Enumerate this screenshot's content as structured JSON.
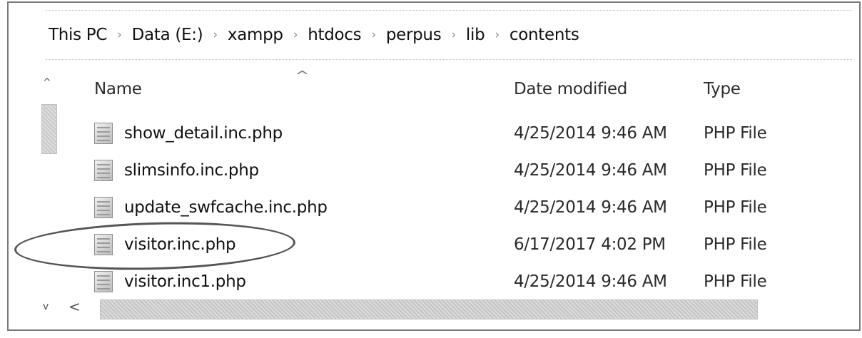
{
  "breadcrumb": {
    "items": [
      "This PC",
      "Data (E:)",
      "xampp",
      "htdocs",
      "perpus",
      "lib",
      "contents"
    ],
    "separator": "›"
  },
  "columns": {
    "name": "Name",
    "date_modified": "Date modified",
    "type": "Type",
    "sort_indicator": "^"
  },
  "files": [
    {
      "name": "show_detail.inc.php",
      "date": "4/25/2014 9:46 AM",
      "type": "PHP File"
    },
    {
      "name": "slimsinfo.inc.php",
      "date": "4/25/2014 9:46 AM",
      "type": "PHP File"
    },
    {
      "name": "update_swfcache.inc.php",
      "date": "4/25/2014 9:46 AM",
      "type": "PHP File"
    },
    {
      "name": "visitor.inc.php",
      "date": "6/17/2017 4:02 PM",
      "type": "PHP File",
      "highlighted": true
    },
    {
      "name": "visitor.inc1.php",
      "date": "4/25/2014 9:46 AM",
      "type": "PHP File"
    }
  ],
  "scrollbar": {
    "up_arrow": "^",
    "down_arrow": "v",
    "left_arrow": "<"
  },
  "icons": {
    "file": "php-file-icon"
  }
}
